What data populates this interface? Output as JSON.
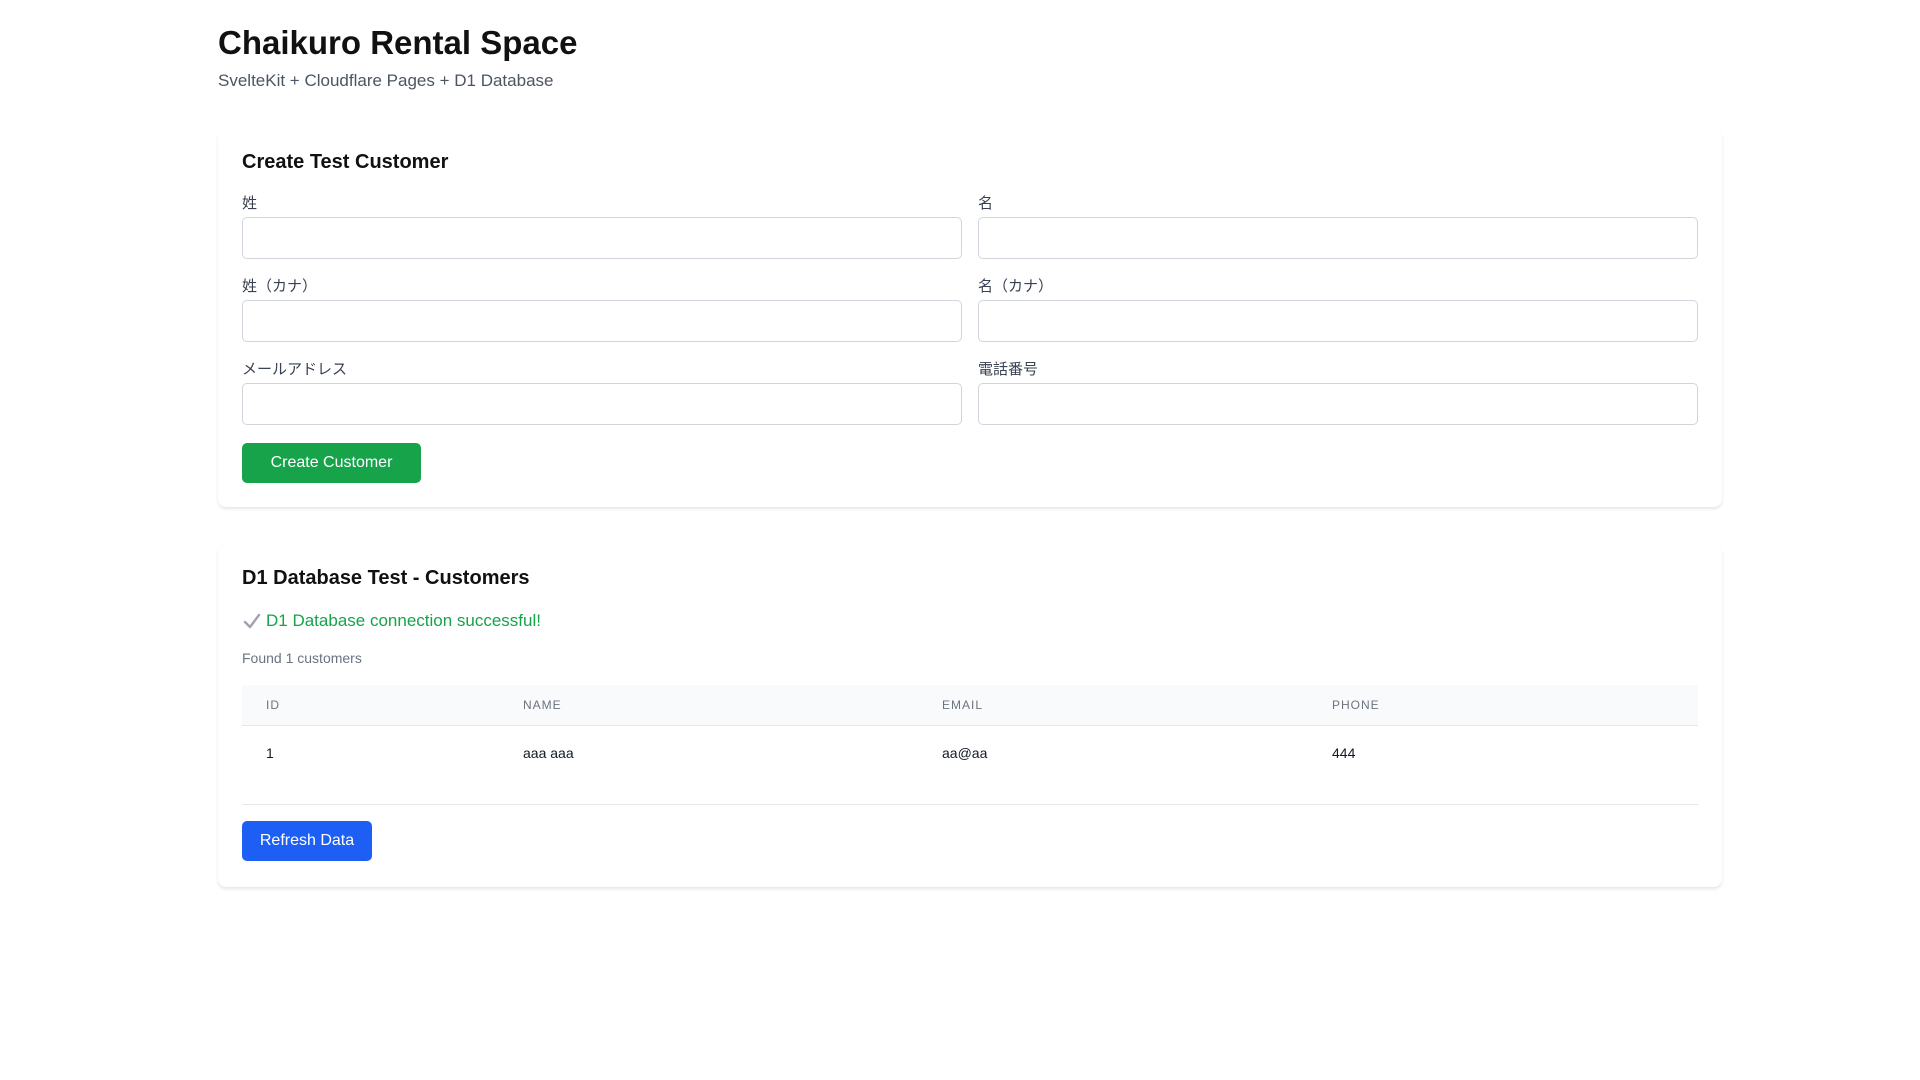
{
  "header": {
    "title": "Chaikuro Rental Space",
    "subtitle": "SvelteKit + Cloudflare Pages + D1 Database"
  },
  "create_form": {
    "title": "Create Test Customer",
    "fields": [
      {
        "label": "姓",
        "value": "",
        "placeholder": ""
      },
      {
        "label": "名",
        "value": "",
        "placeholder": ""
      },
      {
        "label": "姓（カナ）",
        "value": "",
        "placeholder": ""
      },
      {
        "label": "名（カナ）",
        "value": "",
        "placeholder": ""
      },
      {
        "label": "メールアドレス",
        "value": "",
        "placeholder": ""
      },
      {
        "label": "電話番号",
        "value": "",
        "placeholder": ""
      }
    ],
    "submit_label": "Create Customer"
  },
  "database": {
    "title": "D1 Database Test - Customers",
    "status_icon": "check-icon",
    "status_text": "D1 Database connection successful!",
    "found_text": "Found 1 customers",
    "columns": [
      "ID",
      "NAME",
      "EMAIL",
      "PHONE"
    ],
    "rows": [
      {
        "id": "1",
        "name": "aaa aaa",
        "email": "aa@aa",
        "phone": "444"
      }
    ],
    "refresh_label": "Refresh Data"
  },
  "colors": {
    "success": "#16a34a",
    "primary": "#1d5ff5"
  }
}
